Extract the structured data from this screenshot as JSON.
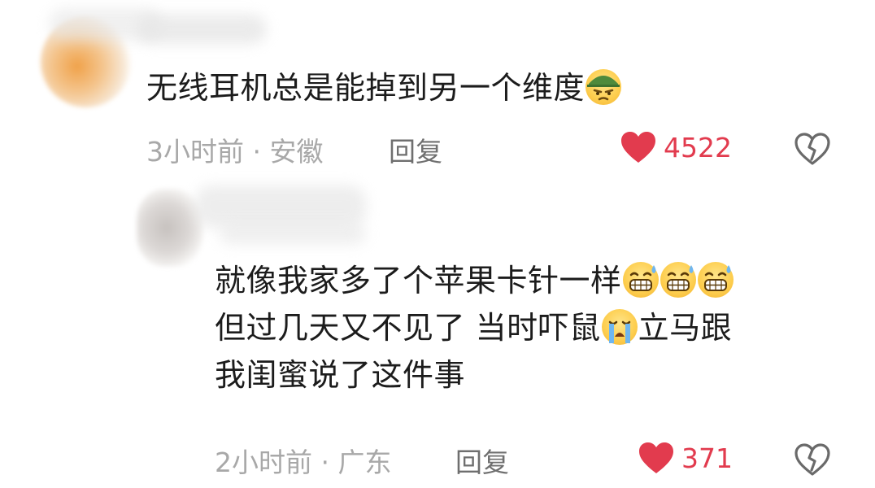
{
  "comments": [
    {
      "body": [
        "无线耳机总是能掉到另一个维度"
      ],
      "emoji_after": [
        "soldier-helmet-emoji"
      ],
      "time": "3小时前",
      "location": "安徽",
      "reply_label": "回复",
      "likes": "4522"
    },
    {
      "lines": [
        {
          "text": "就像我家多了个苹果卡针一样",
          "emojis": [
            "sweat-grin-emoji",
            "sweat-grin-emoji",
            "sweat-grin-emoji"
          ]
        },
        {
          "text_before": "但过几天又不见了 当时吓鼠",
          "emoji": "loudly-crying-emoji",
          "text_after": "立马跟"
        },
        {
          "text": "我闺蜜说了这件事"
        }
      ],
      "time": "2小时前",
      "location": "广东",
      "reply_label": "回复",
      "likes": "371"
    }
  ],
  "colors": {
    "like_red": "#e23b4e",
    "meta_gray": "#a8a8a8",
    "reply_gray": "#6f6f6f"
  }
}
